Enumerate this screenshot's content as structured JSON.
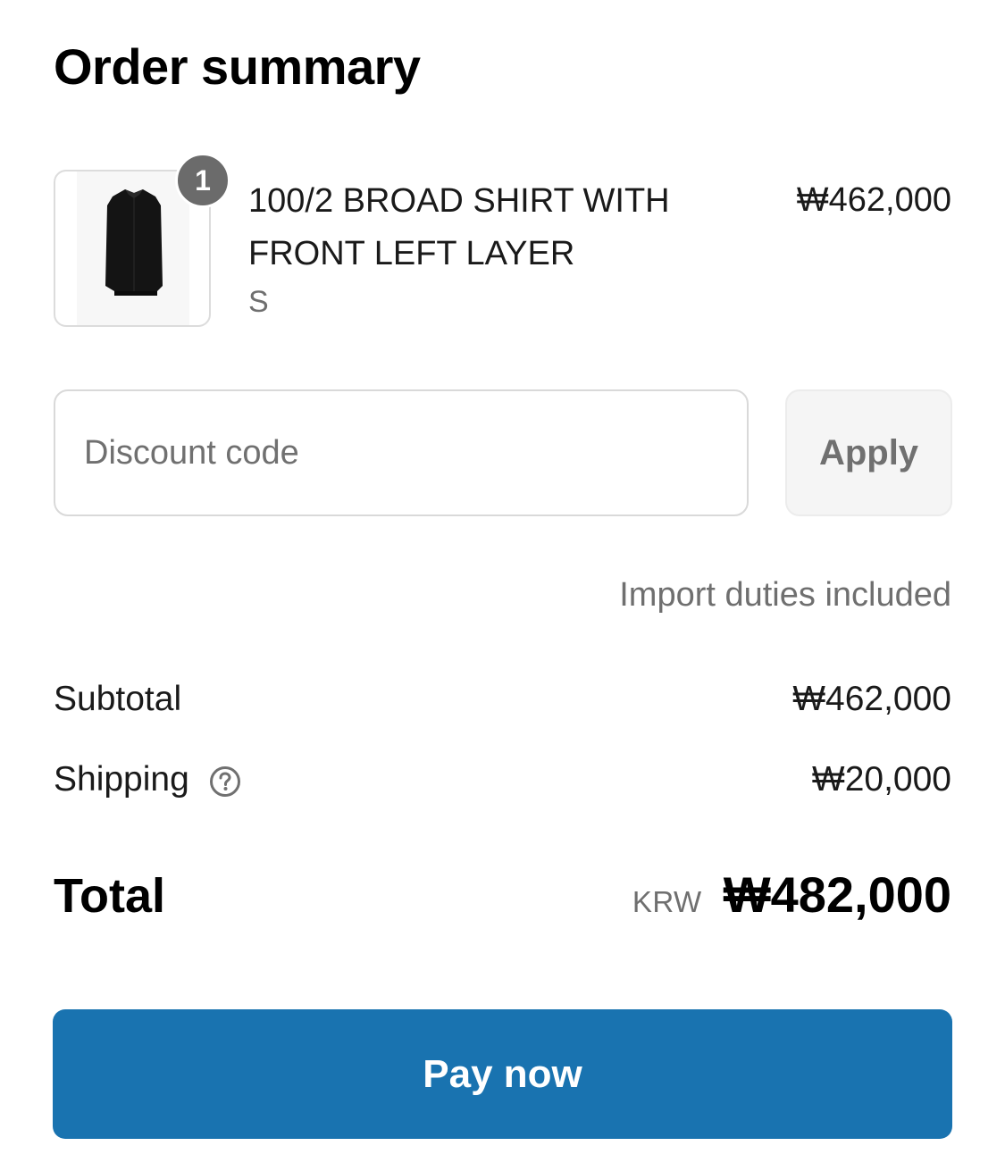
{
  "header": {
    "title": "Order summary"
  },
  "line_item": {
    "quantity": "1",
    "name": "100/2 BROAD SHIRT WITH FRONT LEFT LAYER",
    "variant": "S",
    "price": "₩462,000",
    "image_icon": "black-shirt-image"
  },
  "discount": {
    "placeholder": "Discount code",
    "value": "",
    "apply_label": "Apply"
  },
  "duties_note": "Import duties included",
  "summary": {
    "subtotal_label": "Subtotal",
    "subtotal_value": "₩462,000",
    "shipping_label": "Shipping",
    "shipping_help_icon": "question-circle-icon",
    "shipping_value": "₩20,000",
    "total_label": "Total",
    "currency_code": "KRW",
    "total_value": "₩482,000"
  },
  "pay_button": {
    "label": "Pay now",
    "color": "#1973b0"
  }
}
